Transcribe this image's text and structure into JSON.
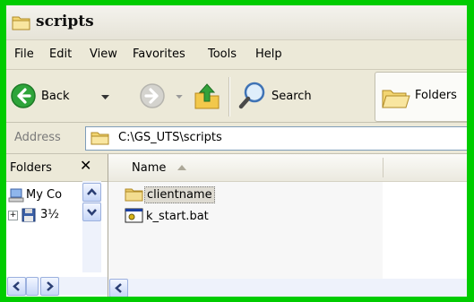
{
  "window": {
    "title": "scripts"
  },
  "menu": {
    "items": [
      {
        "label": "File"
      },
      {
        "label": "Edit"
      },
      {
        "label": "View"
      },
      {
        "label": "Favorites"
      },
      {
        "label": "Tools"
      },
      {
        "label": "Help"
      }
    ]
  },
  "toolbar": {
    "back_label": "Back",
    "search_label": "Search",
    "folders_label": "Folders"
  },
  "address": {
    "label": "Address",
    "value": "C:\\GS_UTS\\scripts"
  },
  "folders_pane": {
    "title": "Folders",
    "close_glyph": "✕",
    "tree_items": [
      {
        "label": "My Co",
        "icon": "my-computer-icon"
      },
      {
        "label": "3½",
        "icon": "floppy-drive-icon"
      }
    ]
  },
  "file_list": {
    "column_name": "Name",
    "items": [
      {
        "name": "clientname",
        "type": "folder",
        "selected": true
      },
      {
        "name": "k_start.bat",
        "type": "batch-file",
        "selected": false
      }
    ]
  },
  "colors": {
    "frame_green": "#00cc00",
    "window_bg": "#ece9d8",
    "back_green": "#2ea43a"
  }
}
